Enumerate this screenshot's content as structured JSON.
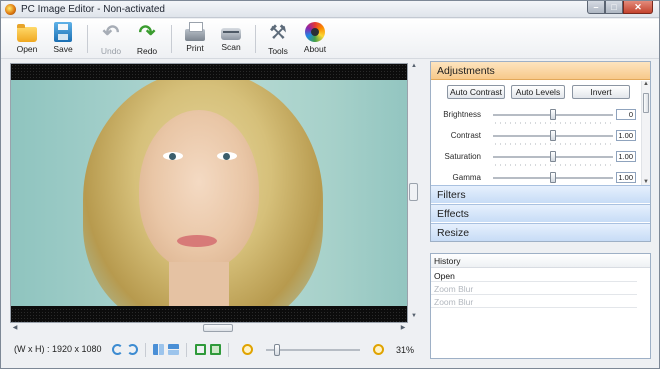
{
  "window": {
    "title": "PC Image Editor - Non-activated"
  },
  "toolbar": {
    "items": [
      {
        "label": "Open",
        "icon": "folder-open-icon",
        "enabled": true
      },
      {
        "label": "Save",
        "icon": "floppy-disk-icon",
        "enabled": true
      },
      {
        "label": "Undo",
        "icon": "undo-arrow-icon",
        "enabled": false
      },
      {
        "label": "Redo",
        "icon": "redo-arrow-icon",
        "enabled": true
      },
      {
        "label": "Print",
        "icon": "printer-icon",
        "enabled": true
      },
      {
        "label": "Scan",
        "icon": "scanner-icon",
        "enabled": true
      },
      {
        "label": "Tools",
        "icon": "tools-icon",
        "enabled": true
      },
      {
        "label": "About",
        "icon": "color-wheel-icon",
        "enabled": true
      }
    ]
  },
  "canvas": {
    "image_description_icon": "portrait-photo"
  },
  "status": {
    "dimensions": "(W x H) : 1920 x 1080",
    "zoom": "31%",
    "zoom_level": 0.08
  },
  "adjustments": {
    "title": "Adjustments",
    "buttons": {
      "auto_contrast": "Auto Contrast",
      "auto_levels": "Auto Levels",
      "invert": "Invert"
    },
    "sliders": [
      {
        "label": "Brightness",
        "value": "0",
        "position": 0.5
      },
      {
        "label": "Contrast",
        "value": "1.00",
        "position": 0.5
      },
      {
        "label": "Saturation",
        "value": "1.00",
        "position": 0.5
      },
      {
        "label": "Gamma",
        "value": "1.00",
        "position": 0.5
      }
    ]
  },
  "sections": {
    "filters": "Filters",
    "effects": "Effects",
    "resize": "Resize"
  },
  "history": {
    "header": "History",
    "items": [
      {
        "label": "Open",
        "active": true
      },
      {
        "label": "Zoom Blur",
        "active": false
      },
      {
        "label": "Zoom Blur",
        "active": false
      }
    ]
  },
  "colors": {
    "accent_orange": "#f7c98a",
    "section_blue": "#c7dcf6",
    "redo_green": "#3a9c2f"
  }
}
